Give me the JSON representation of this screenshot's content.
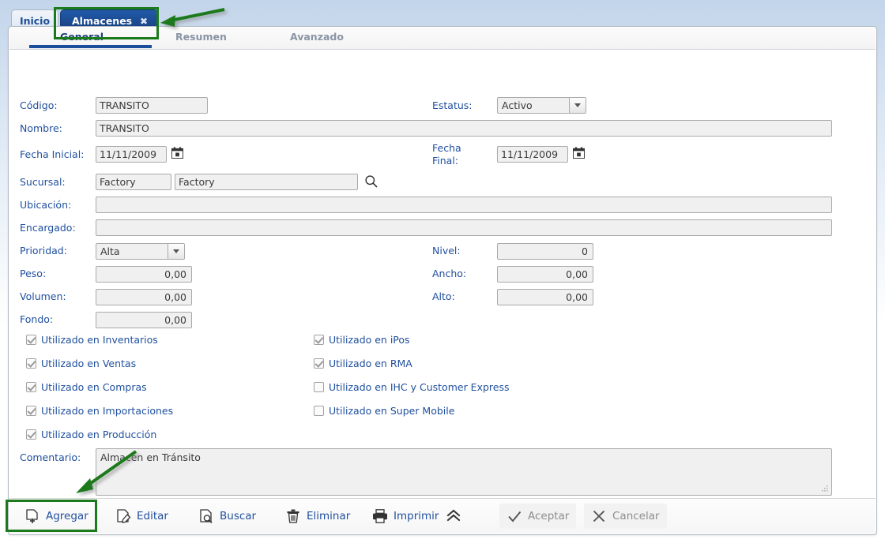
{
  "window": {
    "tabs": [
      {
        "label": "Inicio",
        "active": false,
        "closable": false
      },
      {
        "label": "Almacenes",
        "active": true,
        "closable": true,
        "close_glyph": "✖"
      }
    ]
  },
  "subtabs": [
    {
      "label": "General",
      "active": true
    },
    {
      "label": "Resumen",
      "active": false
    },
    {
      "label": "Avanzado",
      "active": false
    }
  ],
  "form": {
    "codigo": {
      "label": "Código:",
      "value": "TRANSITO"
    },
    "estatus": {
      "label": "Estatus:",
      "value": "Activo"
    },
    "nombre": {
      "label": "Nombre:",
      "value": "TRANSITO"
    },
    "fecha_inicial": {
      "label": "Fecha Inicial:",
      "value": "11/11/2009"
    },
    "fecha_final": {
      "label_line1": "Fecha",
      "label_line2": "Final:",
      "value": "11/11/2009"
    },
    "sucursal": {
      "label": "Sucursal:",
      "code": "Factory",
      "name": "Factory"
    },
    "ubicacion": {
      "label": "Ubicación:",
      "value": ""
    },
    "encargado": {
      "label": "Encargado:",
      "value": ""
    },
    "prioridad": {
      "label": "Prioridad:",
      "value": "Alta"
    },
    "nivel": {
      "label": "Nivel:",
      "value": "0"
    },
    "peso": {
      "label": "Peso:",
      "value": "0,00"
    },
    "ancho": {
      "label": "Ancho:",
      "value": "0,00"
    },
    "volumen": {
      "label": "Volumen:",
      "value": "0,00"
    },
    "alto": {
      "label": "Alto:",
      "value": "0,00"
    },
    "fondo": {
      "label": "Fondo:",
      "value": "0,00"
    },
    "comentario": {
      "label": "Comentario:",
      "value": "Almacén en Tránsito"
    }
  },
  "checkboxes_left": [
    {
      "label": "Utilizado en Inventarios",
      "checked": true
    },
    {
      "label": "Utilizado en Ventas",
      "checked": true
    },
    {
      "label": "Utilizado en Compras",
      "checked": true
    },
    {
      "label": "Utilizado en Importaciones",
      "checked": true
    },
    {
      "label": "Utilizado en Producción",
      "checked": true
    }
  ],
  "checkboxes_right": [
    {
      "label": "Utilizado en iPos",
      "checked": true
    },
    {
      "label": "Utilizado en RMA",
      "checked": true
    },
    {
      "label": "Utilizado en IHC y Customer Express",
      "checked": false
    },
    {
      "label": "Utilizado en Super Mobile",
      "checked": false
    }
  ],
  "toolbar": {
    "agregar": {
      "label": "Agregar",
      "icon": "add-document-icon",
      "enabled": true
    },
    "editar": {
      "label": "Editar",
      "icon": "edit-document-icon",
      "enabled": true
    },
    "buscar": {
      "label": "Buscar",
      "icon": "search-document-icon",
      "enabled": true
    },
    "eliminar": {
      "label": "Eliminar",
      "icon": "trash-icon",
      "enabled": true
    },
    "imprimir": {
      "label": "Imprimir",
      "icon": "printer-icon",
      "enabled": true
    },
    "expand": {
      "label": "",
      "icon": "double-chevron-up-icon",
      "enabled": true
    },
    "aceptar": {
      "label": "Aceptar",
      "icon": "check-icon",
      "enabled": false
    },
    "cancelar": {
      "label": "Cancelar",
      "icon": "x-icon",
      "enabled": false
    }
  },
  "colors": {
    "accent_blue": "#1f4f9e",
    "tab_active_bg": "#1d4f97",
    "annotation_green": "#1b7a1b",
    "field_bg": "#f0f0f0"
  }
}
